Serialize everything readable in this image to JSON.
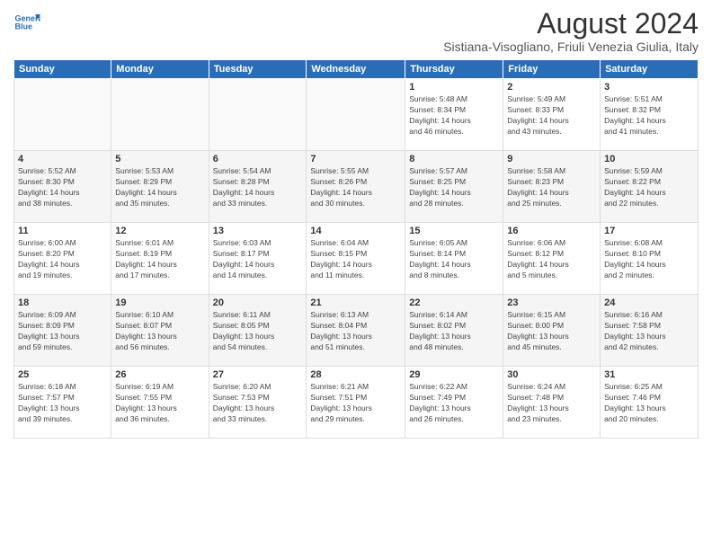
{
  "logo": {
    "line1": "General",
    "line2": "Blue"
  },
  "title": "August 2024",
  "subtitle": "Sistiana-Visogliano, Friuli Venezia Giulia, Italy",
  "header_days": [
    "Sunday",
    "Monday",
    "Tuesday",
    "Wednesday",
    "Thursday",
    "Friday",
    "Saturday"
  ],
  "weeks": [
    [
      {
        "day": "",
        "info": ""
      },
      {
        "day": "",
        "info": ""
      },
      {
        "day": "",
        "info": ""
      },
      {
        "day": "",
        "info": ""
      },
      {
        "day": "1",
        "info": "Sunrise: 5:48 AM\nSunset: 8:34 PM\nDaylight: 14 hours\nand 46 minutes."
      },
      {
        "day": "2",
        "info": "Sunrise: 5:49 AM\nSunset: 8:33 PM\nDaylight: 14 hours\nand 43 minutes."
      },
      {
        "day": "3",
        "info": "Sunrise: 5:51 AM\nSunset: 8:32 PM\nDaylight: 14 hours\nand 41 minutes."
      }
    ],
    [
      {
        "day": "4",
        "info": "Sunrise: 5:52 AM\nSunset: 8:30 PM\nDaylight: 14 hours\nand 38 minutes."
      },
      {
        "day": "5",
        "info": "Sunrise: 5:53 AM\nSunset: 8:29 PM\nDaylight: 14 hours\nand 35 minutes."
      },
      {
        "day": "6",
        "info": "Sunrise: 5:54 AM\nSunset: 8:28 PM\nDaylight: 14 hours\nand 33 minutes."
      },
      {
        "day": "7",
        "info": "Sunrise: 5:55 AM\nSunset: 8:26 PM\nDaylight: 14 hours\nand 30 minutes."
      },
      {
        "day": "8",
        "info": "Sunrise: 5:57 AM\nSunset: 8:25 PM\nDaylight: 14 hours\nand 28 minutes."
      },
      {
        "day": "9",
        "info": "Sunrise: 5:58 AM\nSunset: 8:23 PM\nDaylight: 14 hours\nand 25 minutes."
      },
      {
        "day": "10",
        "info": "Sunrise: 5:59 AM\nSunset: 8:22 PM\nDaylight: 14 hours\nand 22 minutes."
      }
    ],
    [
      {
        "day": "11",
        "info": "Sunrise: 6:00 AM\nSunset: 8:20 PM\nDaylight: 14 hours\nand 19 minutes."
      },
      {
        "day": "12",
        "info": "Sunrise: 6:01 AM\nSunset: 8:19 PM\nDaylight: 14 hours\nand 17 minutes."
      },
      {
        "day": "13",
        "info": "Sunrise: 6:03 AM\nSunset: 8:17 PM\nDaylight: 14 hours\nand 14 minutes."
      },
      {
        "day": "14",
        "info": "Sunrise: 6:04 AM\nSunset: 8:15 PM\nDaylight: 14 hours\nand 11 minutes."
      },
      {
        "day": "15",
        "info": "Sunrise: 6:05 AM\nSunset: 8:14 PM\nDaylight: 14 hours\nand 8 minutes."
      },
      {
        "day": "16",
        "info": "Sunrise: 6:06 AM\nSunset: 8:12 PM\nDaylight: 14 hours\nand 5 minutes."
      },
      {
        "day": "17",
        "info": "Sunrise: 6:08 AM\nSunset: 8:10 PM\nDaylight: 14 hours\nand 2 minutes."
      }
    ],
    [
      {
        "day": "18",
        "info": "Sunrise: 6:09 AM\nSunset: 8:09 PM\nDaylight: 13 hours\nand 59 minutes."
      },
      {
        "day": "19",
        "info": "Sunrise: 6:10 AM\nSunset: 8:07 PM\nDaylight: 13 hours\nand 56 minutes."
      },
      {
        "day": "20",
        "info": "Sunrise: 6:11 AM\nSunset: 8:05 PM\nDaylight: 13 hours\nand 54 minutes."
      },
      {
        "day": "21",
        "info": "Sunrise: 6:13 AM\nSunset: 8:04 PM\nDaylight: 13 hours\nand 51 minutes."
      },
      {
        "day": "22",
        "info": "Sunrise: 6:14 AM\nSunset: 8:02 PM\nDaylight: 13 hours\nand 48 minutes."
      },
      {
        "day": "23",
        "info": "Sunrise: 6:15 AM\nSunset: 8:00 PM\nDaylight: 13 hours\nand 45 minutes."
      },
      {
        "day": "24",
        "info": "Sunrise: 6:16 AM\nSunset: 7:58 PM\nDaylight: 13 hours\nand 42 minutes."
      }
    ],
    [
      {
        "day": "25",
        "info": "Sunrise: 6:18 AM\nSunset: 7:57 PM\nDaylight: 13 hours\nand 39 minutes."
      },
      {
        "day": "26",
        "info": "Sunrise: 6:19 AM\nSunset: 7:55 PM\nDaylight: 13 hours\nand 36 minutes."
      },
      {
        "day": "27",
        "info": "Sunrise: 6:20 AM\nSunset: 7:53 PM\nDaylight: 13 hours\nand 33 minutes."
      },
      {
        "day": "28",
        "info": "Sunrise: 6:21 AM\nSunset: 7:51 PM\nDaylight: 13 hours\nand 29 minutes."
      },
      {
        "day": "29",
        "info": "Sunrise: 6:22 AM\nSunset: 7:49 PM\nDaylight: 13 hours\nand 26 minutes."
      },
      {
        "day": "30",
        "info": "Sunrise: 6:24 AM\nSunset: 7:48 PM\nDaylight: 13 hours\nand 23 minutes."
      },
      {
        "day": "31",
        "info": "Sunrise: 6:25 AM\nSunset: 7:46 PM\nDaylight: 13 hours\nand 20 minutes."
      }
    ]
  ]
}
